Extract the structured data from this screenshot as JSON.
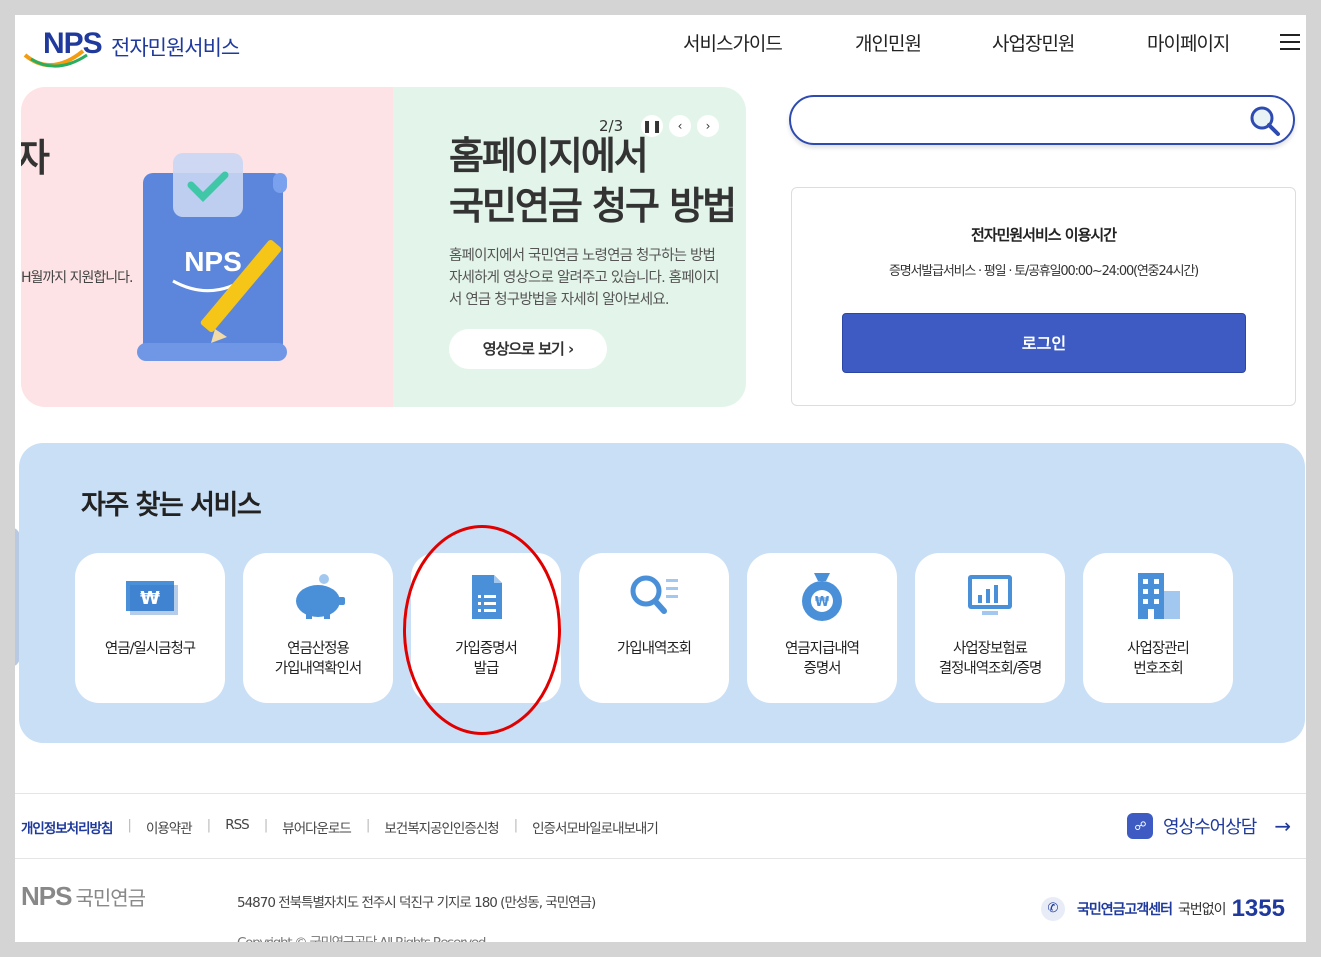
{
  "header": {
    "logo_text": "NPS",
    "logo_sub": "전자민원서비스",
    "nav": [
      "서비스가이드",
      "개인민원",
      "사업장민원",
      "마이페이지"
    ]
  },
  "banner": {
    "cut_char": "자",
    "cut_sub": "H월까지 지원합니다.",
    "pager": "2/3",
    "title_line1": "홈페이지에서",
    "title_line2": "국민연금 청구 방법",
    "desc_line1": "홈페이지에서 국민연금 노령연금 청구하는 방법",
    "desc_line2": "자세하게 영상으로 알려주고 있습니다. 홈페이지",
    "desc_line3": "서 연금 청구방법을 자세히 알아보세요.",
    "button": "영상으로 보기  ›",
    "doc_logo": "NPS"
  },
  "search": {
    "placeholder": "",
    "value": ""
  },
  "login_box": {
    "title": "전자민원서비스 이용시간",
    "hours": "증명서발급서비스 · 평일 · 토/공휴일00:00~24:00(연중24시간)",
    "login_button": "로그인"
  },
  "quick": {
    "title": "자주 찾는 서비스",
    "cards": [
      {
        "line1": "연금/일시금청구",
        "line2": "",
        "icon": "won-card-icon"
      },
      {
        "line1": "연금산정용",
        "line2": "가입내역확인서",
        "icon": "piggy-bank-icon"
      },
      {
        "line1": "가입증명서",
        "line2": "발급",
        "icon": "document-icon"
      },
      {
        "line1": "가입내역조회",
        "line2": "",
        "icon": "search-list-icon"
      },
      {
        "line1": "연금지급내역",
        "line2": "증명서",
        "icon": "money-bag-icon"
      },
      {
        "line1": "사업장보험료",
        "line2": "결정내역조회/증명",
        "icon": "chart-monitor-icon"
      },
      {
        "line1": "사업장관리",
        "line2": "번호조회",
        "icon": "building-icon"
      }
    ]
  },
  "footer": {
    "links": [
      "개인정보처리방침",
      "이용약관",
      "RSS",
      "뷰어다운로드",
      "보건복지공인인증신청",
      "인증서모바일로내보내기"
    ],
    "video_consult": "영상수어상담",
    "logo_nps": "NPS",
    "logo_kor": "국민연금",
    "address": "54870 전북특별자치도 전주시 덕진구 기지로 180 (만성동, 국민연금)",
    "copyright": "Copyright © 국민연금공단 All Rights Reserved.",
    "callcenter_name": "국민연금고객센터",
    "callcenter_toll": "국번없이",
    "callcenter_number": "1355"
  },
  "colors": {
    "brand": "#1f3a9c",
    "login_button": "#3d5bc2",
    "quick_bg": "#c9dff6",
    "highlight": "#e00000"
  }
}
